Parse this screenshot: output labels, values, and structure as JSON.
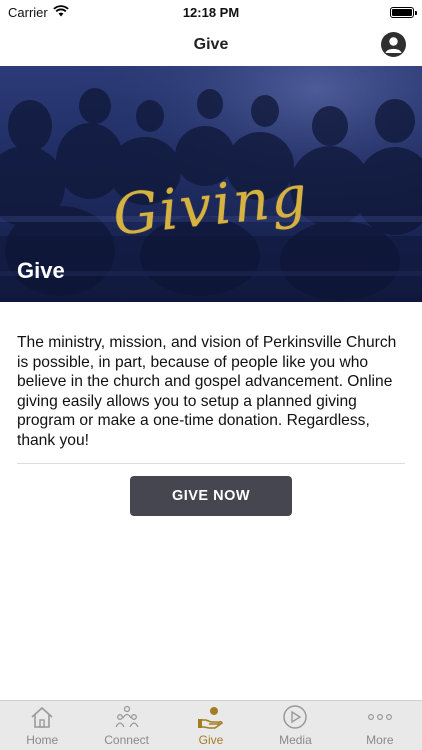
{
  "status_bar": {
    "carrier": "Carrier",
    "time": "12:18 PM"
  },
  "nav": {
    "title": "Give"
  },
  "hero": {
    "script_text": "Giving",
    "title": "Give"
  },
  "main": {
    "description": "The ministry, mission, and vision of Perkinsville Church is possible, in part, because of people like you who believe in the church and gospel advancement. Online giving easily allows you to setup a planned giving program or make a one-time donation. Regardless, thank you!",
    "give_button_label": "GIVE NOW"
  },
  "tab_bar": {
    "items": [
      {
        "label": "Home",
        "icon": "home-icon"
      },
      {
        "label": "Connect",
        "icon": "people-icon"
      },
      {
        "label": "Give",
        "icon": "give-hand-icon",
        "active": true
      },
      {
        "label": "Media",
        "icon": "play-icon"
      },
      {
        "label": "More",
        "icon": "more-icon"
      }
    ]
  },
  "colors": {
    "accent": "#a37d22",
    "button": "#464651",
    "hero_gold": "#d6b243"
  }
}
